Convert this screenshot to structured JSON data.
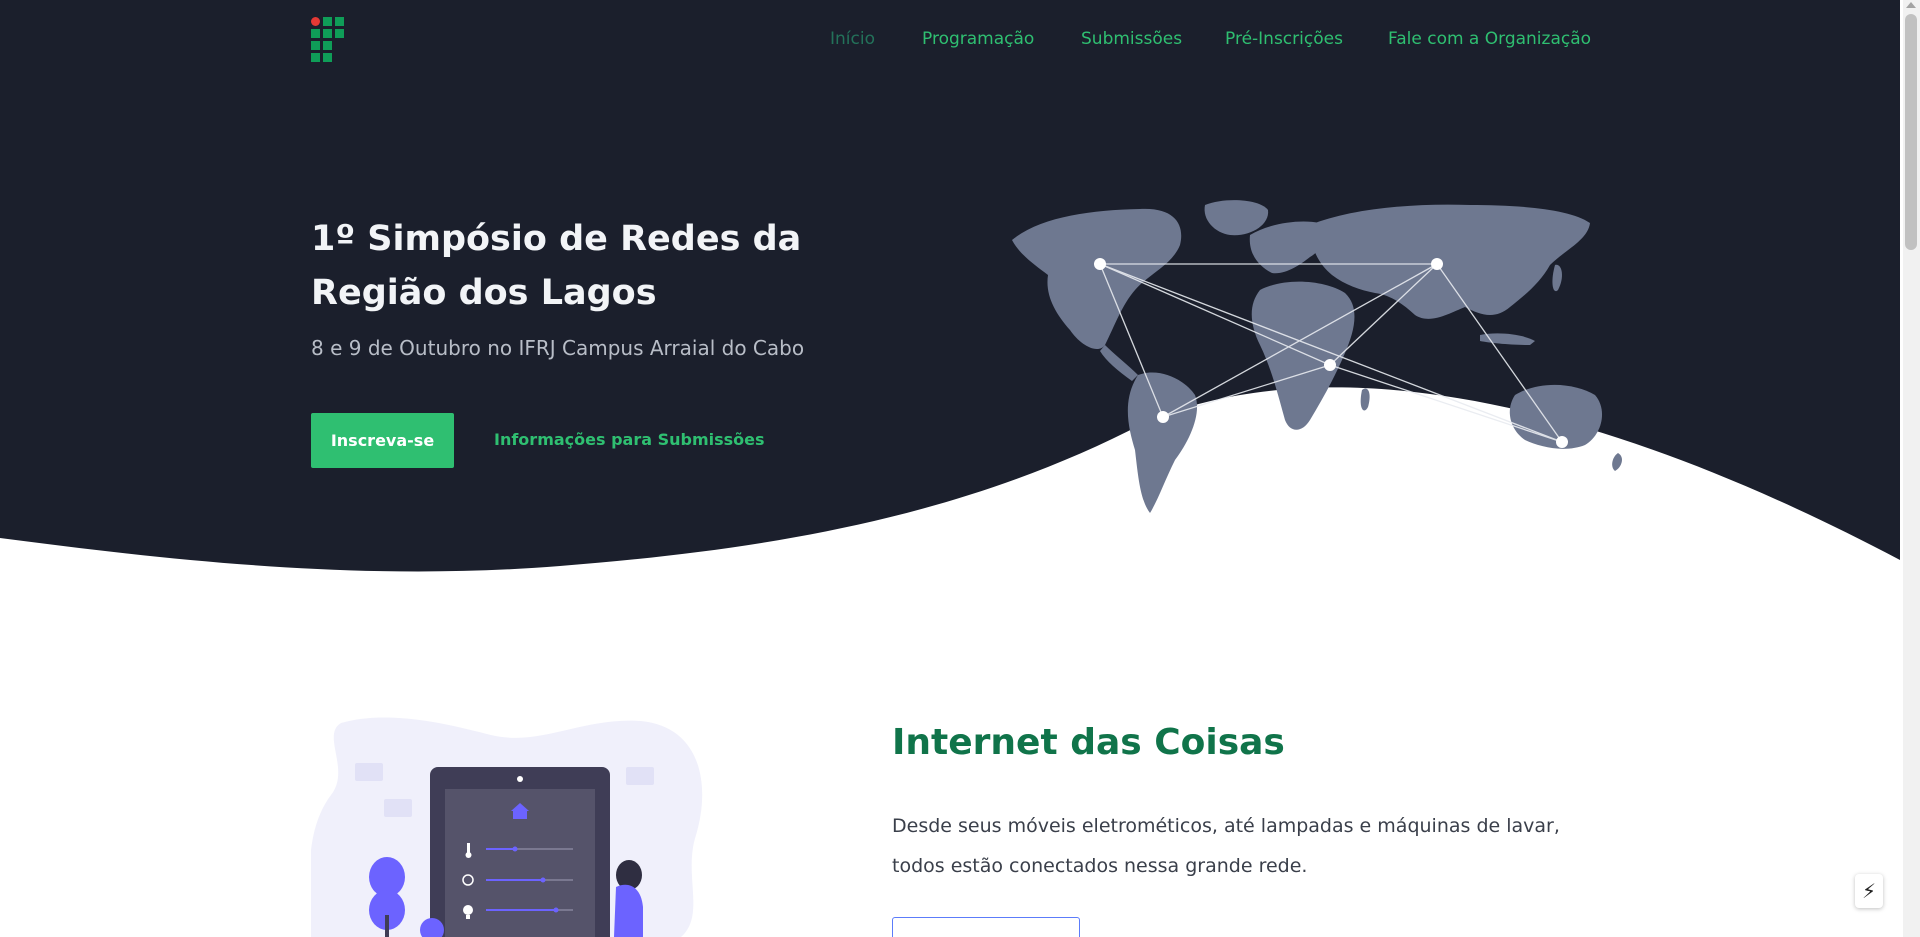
{
  "nav": {
    "items": [
      {
        "label": "Início",
        "active": true
      },
      {
        "label": "Programação",
        "active": false
      },
      {
        "label": "Submissões",
        "active": false
      },
      {
        "label": "Pré-Inscrições",
        "active": false
      },
      {
        "label": "Fale com a Organização",
        "active": false
      }
    ]
  },
  "hero": {
    "title_line1": "1º Simpósio de Redes da",
    "title_line2": "Região dos Lagos",
    "subtitle": "8 e 9 de Outubro no IFRJ Campus Arraial do Cabo",
    "primary_button": "Inscreva-se",
    "secondary_link": "Informações para Submissões"
  },
  "section": {
    "title": "Internet das Coisas",
    "text": "Desde seus móveis eletrométicos, até lampadas e máquinas de lavar, todos estão conectados nessa grande rede."
  },
  "icons": {
    "logo": "ifrj-logo-icon",
    "map": "world-map-network-icon",
    "illustration": "smart-home-tablet-icon",
    "floating": "lightning-bolt-icon"
  },
  "colors": {
    "hero_bg": "#1b1f2c",
    "accent_green": "#2fbf71",
    "title_green": "#10744a",
    "map_land": "#6e7890"
  }
}
